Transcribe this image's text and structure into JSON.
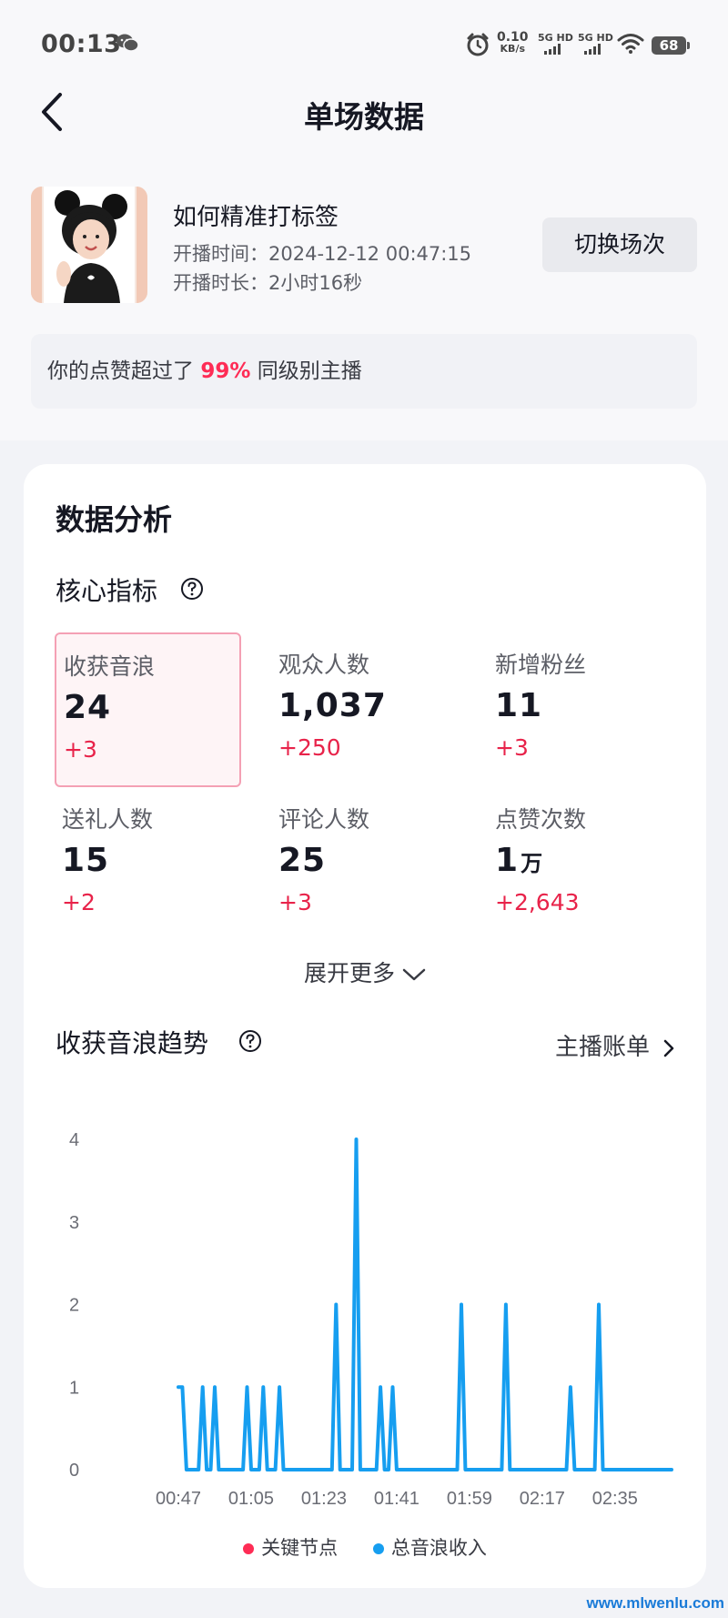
{
  "status_bar": {
    "time": "00:13",
    "net_speed_value": "0.10",
    "net_speed_unit": "KB/s",
    "sim1_label": "5G HD",
    "sim2_label": "5G HD",
    "battery": "68",
    "icons": [
      "wechat-icon",
      "alarm-icon",
      "signal-icon",
      "wifi-icon",
      "battery-icon"
    ]
  },
  "header": {
    "title": "单场数据",
    "back_icon": "chevron-left-icon"
  },
  "session": {
    "title": "如何精准打标签",
    "start_time": "开播时间：2024-12-12 00:47:15",
    "duration": "开播时长：2小时16秒",
    "switch_label": "切换场次"
  },
  "compare": {
    "prefix": "你的点赞超过了",
    "percent": "99%",
    "suffix": "同级别主播"
  },
  "analysis": {
    "title": "数据分析",
    "core_title": "核心指标",
    "metrics": [
      {
        "label": "收获音浪",
        "value": "24",
        "unit": "",
        "delta": "+3",
        "selected": true
      },
      {
        "label": "观众人数",
        "value": "1,037",
        "unit": "",
        "delta": "+250",
        "selected": false
      },
      {
        "label": "新增粉丝",
        "value": "11",
        "unit": "",
        "delta": "+3",
        "selected": false
      },
      {
        "label": "送礼人数",
        "value": "15",
        "unit": "",
        "delta": "+2",
        "selected": false
      },
      {
        "label": "评论人数",
        "value": "25",
        "unit": "",
        "delta": "+3",
        "selected": false
      },
      {
        "label": "点赞次数",
        "value": "1",
        "unit": "万",
        "delta": "+2,643",
        "selected": false
      }
    ],
    "expand_label": "展开更多",
    "trend_title": "收获音浪趋势",
    "bill_link": "主播账单"
  },
  "chart_data": {
    "type": "line",
    "ylim": [
      0,
      4
    ],
    "y_ticks": [
      "0",
      "1",
      "2",
      "3",
      "4"
    ],
    "x_ticks": [
      "00:47",
      "01:05",
      "01:23",
      "01:41",
      "01:59",
      "02:17",
      "02:35"
    ],
    "x_range_minutes": [
      47,
      169
    ],
    "series": [
      {
        "name": "总音浪收入",
        "color": "#169ef0",
        "points": [
          [
            47,
            1
          ],
          [
            48,
            1
          ],
          [
            49,
            0
          ],
          [
            52,
            0
          ],
          [
            53,
            1
          ],
          [
            54,
            0
          ],
          [
            55,
            0
          ],
          [
            56,
            1
          ],
          [
            57,
            0
          ],
          [
            63,
            0
          ],
          [
            64,
            1
          ],
          [
            65,
            0
          ],
          [
            67,
            0
          ],
          [
            68,
            1
          ],
          [
            69,
            0
          ],
          [
            71,
            0
          ],
          [
            72,
            1
          ],
          [
            73,
            0
          ],
          [
            85,
            0
          ],
          [
            86,
            2
          ],
          [
            87,
            0
          ],
          [
            90,
            0
          ],
          [
            91,
            4
          ],
          [
            92,
            0
          ],
          [
            96,
            0
          ],
          [
            97,
            1
          ],
          [
            98,
            0
          ],
          [
            99,
            0
          ],
          [
            100,
            1
          ],
          [
            101,
            0
          ],
          [
            116,
            0
          ],
          [
            117,
            2
          ],
          [
            118,
            0
          ],
          [
            127,
            0
          ],
          [
            128,
            2
          ],
          [
            129,
            0
          ],
          [
            143,
            0
          ],
          [
            144,
            1
          ],
          [
            145,
            0
          ],
          [
            150,
            0
          ],
          [
            151,
            2
          ],
          [
            152,
            0
          ],
          [
            169,
            0
          ]
        ]
      }
    ],
    "legend": [
      {
        "name": "关键节点",
        "color": "#fe2c55"
      },
      {
        "name": "总音浪收入",
        "color": "#169ef0"
      }
    ]
  },
  "watermark": "www.mlwenlu.com"
}
